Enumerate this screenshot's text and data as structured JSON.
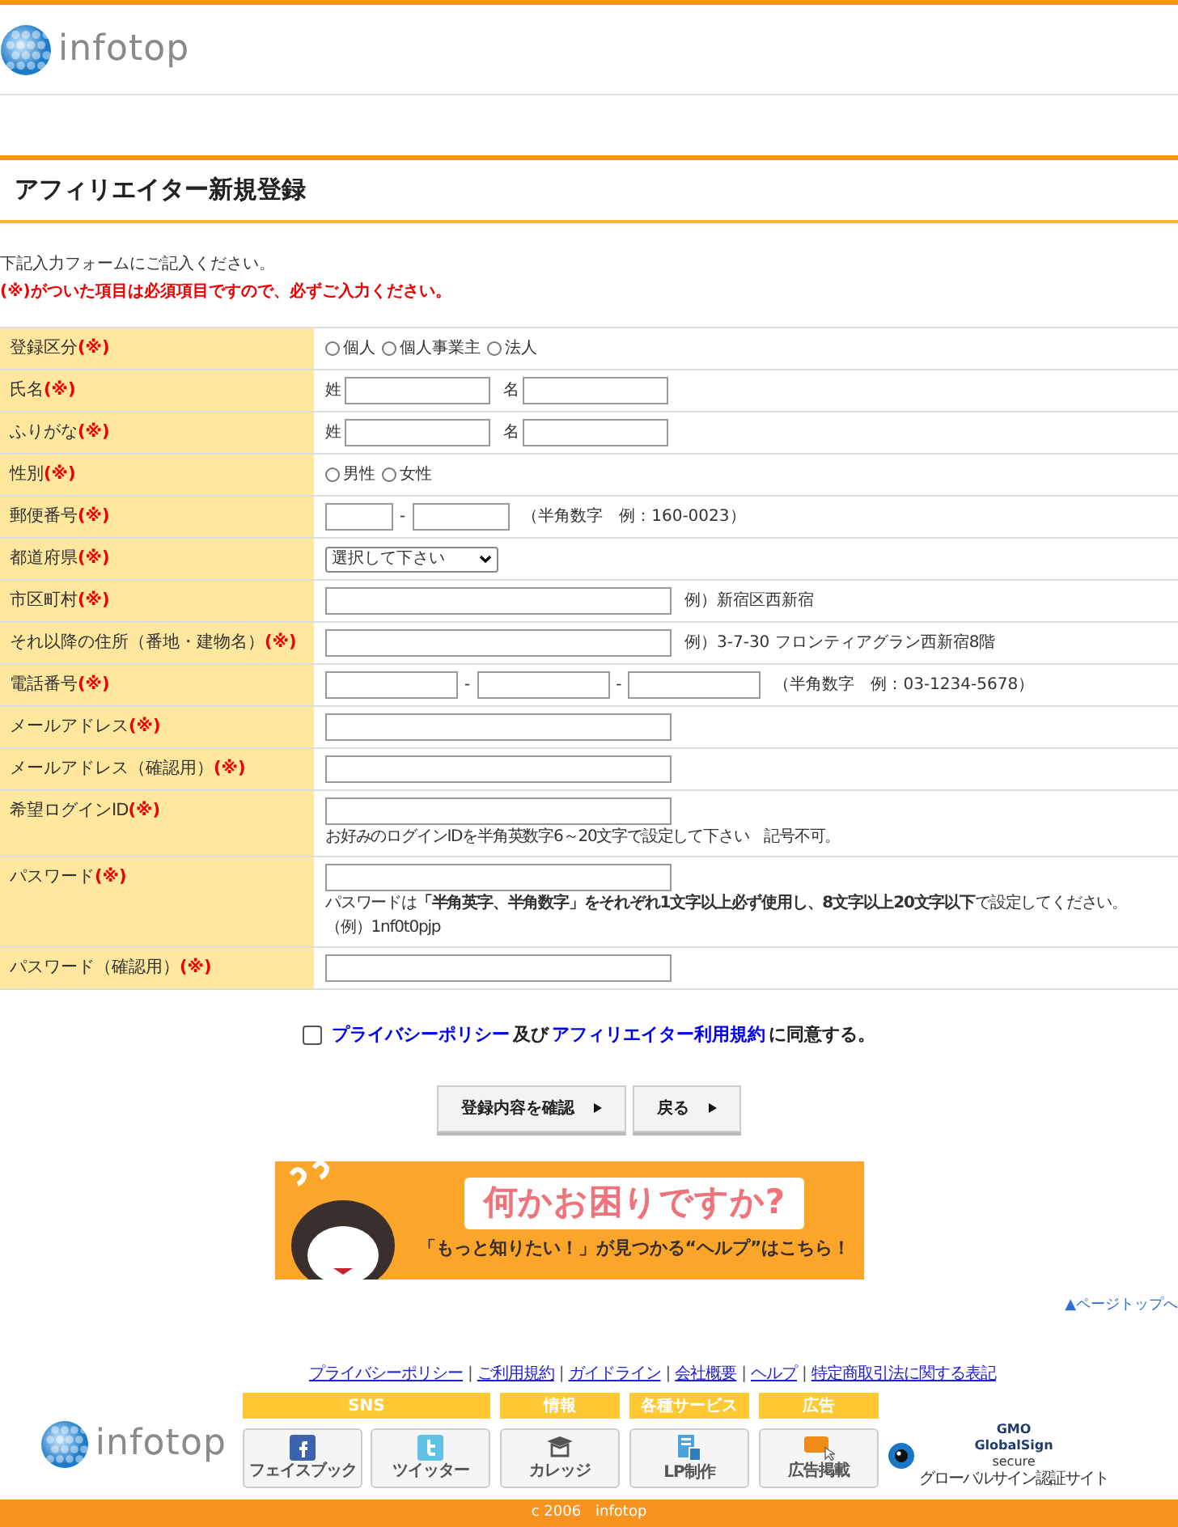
{
  "header": {
    "logo": "infotop"
  },
  "page_title": "アフィリエイター新規登録",
  "intro": {
    "text": "下記入力フォームにご記入ください。",
    "required_note": "(※)がついた項目は必須項目ですので、必ずご入力ください。"
  },
  "form_rows": [
    {
      "label": "登録区分",
      "required_mark": "(※)",
      "parts": [
        {
          "kind": "radio",
          "label": "個人",
          "selected": false
        },
        {
          "kind": "radio",
          "label": "個人事業主",
          "selected": false
        },
        {
          "kind": "radio",
          "label": "法人",
          "selected": false
        }
      ]
    },
    {
      "label": "氏名",
      "required_mark": "(※)",
      "parts": [
        {
          "kind": "prefix",
          "text": "姓"
        },
        {
          "kind": "nameinput"
        },
        {
          "kind": "prefix",
          "text": "名"
        },
        {
          "kind": "nameinput"
        }
      ]
    },
    {
      "label": "ふりがな",
      "required_mark": "(※)",
      "parts": [
        {
          "kind": "prefix",
          "text": "姓"
        },
        {
          "kind": "nameinput"
        },
        {
          "kind": "prefix",
          "text": "名"
        },
        {
          "kind": "nameinput"
        }
      ]
    },
    {
      "label": "性別",
      "required_mark": "(※)",
      "parts": [
        {
          "kind": "radio",
          "label": "男性",
          "selected": false
        },
        {
          "kind": "radio",
          "label": "女性",
          "selected": false
        }
      ]
    },
    {
      "label": "郵便番号",
      "required_mark": "(※)",
      "parts": [
        {
          "kind": "shortinput"
        },
        {
          "kind": "separator",
          "text": "-"
        },
        {
          "kind": "zipinput"
        },
        {
          "kind": "note",
          "text": "（半角数字　例：160-0023）"
        }
      ]
    },
    {
      "label": "都道府県",
      "required_mark": "(※)",
      "parts": [
        {
          "kind": "select",
          "value": "選択して下さい"
        }
      ]
    },
    {
      "label": "市区町村",
      "required_mark": "(※)",
      "parts": [
        {
          "kind": "longinput"
        },
        {
          "kind": "note",
          "text": "例）新宿区西新宿"
        }
      ]
    },
    {
      "label": "それ以降の住所（番地・建物名）",
      "required_mark": "(※)",
      "parts": [
        {
          "kind": "longinput"
        },
        {
          "kind": "note",
          "text": "例）3-7-30 フロンティアグラン西新宿8階"
        }
      ]
    },
    {
      "label": "電話番号",
      "required_mark": "(※)",
      "parts": [
        {
          "kind": "telinput"
        },
        {
          "kind": "separator",
          "text": "-"
        },
        {
          "kind": "telinput"
        },
        {
          "kind": "separator",
          "text": "-"
        },
        {
          "kind": "telinput"
        },
        {
          "kind": "note",
          "text": "（半角数字　例：03-1234-5678）"
        }
      ]
    },
    {
      "label": "メールアドレス",
      "required_mark": "(※)",
      "parts": [
        {
          "kind": "longinput"
        }
      ]
    },
    {
      "label": "メールアドレス（確認用）",
      "required_mark": "(※)",
      "parts": [
        {
          "kind": "longinput"
        }
      ]
    },
    {
      "label": "希望ログインID",
      "required_mark": "(※)",
      "parts": [
        {
          "kind": "longinput"
        }
      ],
      "help": [
        "お好みのログインIDを半角英数字6～20文字で設定して下さい　記号不可。"
      ]
    },
    {
      "label": "パスワード",
      "required_mark": "(※)",
      "parts": [
        {
          "kind": "longinput"
        }
      ],
      "help": [
        "パスワードは**「半角英字、半角数字」をそれぞれ1文字以上必ず使用し、8文字以上20文字以下**で設定してください。",
        "（例）1nf0t0pjp"
      ]
    },
    {
      "label": "パスワード（確認用）",
      "required_mark": "(※)",
      "parts": [
        {
          "kind": "longinput"
        }
      ]
    }
  ],
  "agreement": {
    "checked": false,
    "parts": [
      {
        "kind": "link",
        "text": "プライバシーポリシー"
      },
      {
        "kind": "text",
        "text": "及び"
      },
      {
        "kind": "link",
        "text": "アフィリエイター利用規約"
      },
      {
        "kind": "text",
        "text": "に同意する。"
      }
    ]
  },
  "buttons": [
    "登録内容を確認",
    "戻る"
  ],
  "help_banner": {
    "headline": "何かお困りですか?",
    "tagline": "「もっと知りたい！」が見つかる“ヘルプ”はこちら！"
  },
  "page_top_link": "▲ページトップへ",
  "footer": {
    "links": [
      "プライバシーポリシー",
      "ご利用規約",
      "ガイドライン",
      "会社概要",
      "ヘルプ",
      "特定商取引法に関する表記"
    ],
    "separator": "|",
    "logo": "infotop",
    "groups": [
      {
        "title": "SNS",
        "items": [
          {
            "label": "フェイスブック",
            "kind": "facebook"
          },
          {
            "label": "ツイッター",
            "kind": "twitter"
          }
        ]
      },
      {
        "title": "情報",
        "items": [
          {
            "label": "カレッジ",
            "kind": "college"
          }
        ]
      },
      {
        "title": "各種サービス",
        "items": [
          {
            "label": "LP制作",
            "kind": "lp"
          }
        ]
      },
      {
        "title": "広告",
        "items": [
          {
            "label": "広告掲載",
            "kind": "pr"
          }
        ]
      }
    ],
    "seal": {
      "brand": "GMO",
      "name": "GlobalSign",
      "word": "secure",
      "caption": "グローバルサイン認証サイト"
    },
    "copyright": "c 2006　infotop"
  }
}
